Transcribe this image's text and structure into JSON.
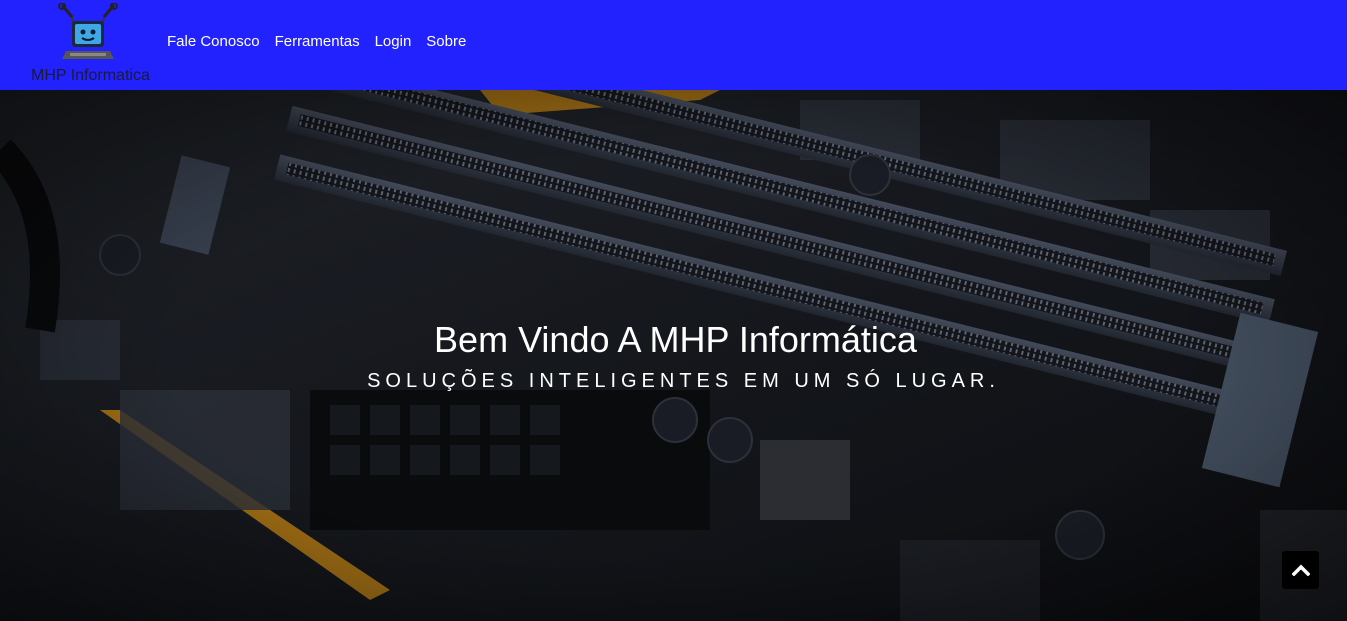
{
  "brand": {
    "name": "MHP Informatica",
    "logo_icon": "robot-computer-logo"
  },
  "nav": {
    "items": [
      {
        "label": "Fale Conosco"
      },
      {
        "label": "Ferramentas"
      },
      {
        "label": "Login"
      },
      {
        "label": "Sobre"
      }
    ]
  },
  "hero": {
    "title": "Bem Vindo A MHP Informática",
    "subtitle": "SOLUÇÕES INTELIGENTES EM UM SÓ LUGAR.",
    "background": "motherboard-ram-slots-photo"
  },
  "scroll_top": {
    "icon": "chevron-up-icon"
  },
  "colors": {
    "navbar": "#2222ff",
    "nav_text": "#ffffff",
    "hero_text": "#ffffff",
    "scroll_button": "#000000"
  }
}
